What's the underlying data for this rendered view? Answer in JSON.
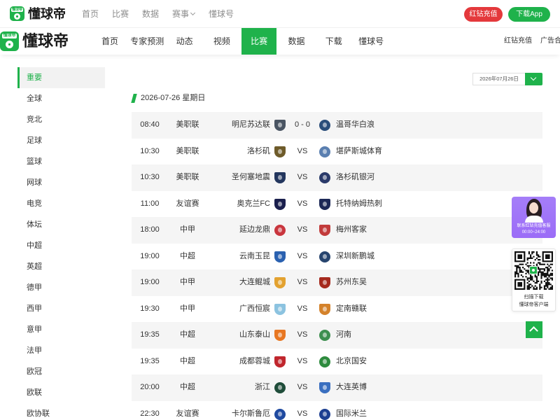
{
  "colors": {
    "accent_green": "#1fb24b",
    "recharge_red": "#e4393c",
    "text_dark": "#333333",
    "text_gray": "#8c8c8c",
    "row_alt_bg": "#f5f5f5",
    "service_purple": "#9b6cf7"
  },
  "top_bar": {
    "logo_icon": "dongqiudi-logo-icon",
    "logo_badge_text": "懂球帝",
    "brand": "懂球帝",
    "nav": [
      "首页",
      "比赛",
      "数据",
      "赛事",
      "懂球号"
    ],
    "dropdown_icon": "chevron-down-icon",
    "recharge_button": "红钻充值",
    "download_button": "下载App"
  },
  "main_nav": {
    "logo_badge_text": "懂球帝",
    "brand": "懂球帝",
    "items": [
      "首页",
      "专家预测",
      "动态",
      "视频",
      "比赛",
      "数据",
      "下载",
      "懂球号"
    ],
    "active_index": 4,
    "recharge_link": "红钻充值",
    "ad_link": "广告合"
  },
  "sidebar": {
    "items": [
      "重要",
      "全球",
      "竞北",
      "足球",
      "篮球",
      "网球",
      "电竞",
      "体坛",
      "中超",
      "英超",
      "德甲",
      "西甲",
      "意甲",
      "法甲",
      "欧冠",
      "欧联",
      "欧协联"
    ],
    "active_index": 0
  },
  "date_picker": {
    "value": "2026年07月26日",
    "icon": "chevron-down-icon"
  },
  "date_header": "2026-07-26 星期日",
  "matches": [
    {
      "time": "08:40",
      "league": "美职联",
      "home": "明尼苏达联",
      "score": "0 - 0",
      "away": "温哥华白浪",
      "home_logo": {
        "icon": "shield-crest",
        "color": "#4a5563"
      },
      "away_logo": {
        "icon": "round-crest",
        "color": "#2a4d7a"
      }
    },
    {
      "time": "10:30",
      "league": "美职联",
      "home": "洛杉矶",
      "score": "VS",
      "away": "堪萨斯城体育",
      "home_logo": {
        "icon": "shield-crest",
        "color": "#6e5b2a"
      },
      "away_logo": {
        "icon": "round-crest",
        "color": "#5a7fb0"
      }
    },
    {
      "time": "10:30",
      "league": "美职联",
      "home": "圣何塞地震",
      "score": "VS",
      "away": "洛杉矶银河",
      "home_logo": {
        "icon": "shield-crest",
        "color": "#23365e"
      },
      "away_logo": {
        "icon": "round-crest",
        "color": "#2a3a6a"
      }
    },
    {
      "time": "11:00",
      "league": "友谊赛",
      "home": "奥克兰FC",
      "score": "VS",
      "away": "托特纳姆热刺",
      "home_logo": {
        "icon": "shield-crest",
        "color": "#1a1f4d"
      },
      "away_logo": {
        "icon": "shield-crest",
        "color": "#1c2856"
      }
    },
    {
      "time": "18:00",
      "league": "中甲",
      "home": "延边龙鼎",
      "score": "VS",
      "away": "梅州客家",
      "home_logo": {
        "icon": "round-crest",
        "color": "#c9363e"
      },
      "away_logo": {
        "icon": "shield-crest",
        "color": "#c23b3b"
      }
    },
    {
      "time": "19:00",
      "league": "中超",
      "home": "云南玉昆",
      "score": "VS",
      "away": "深圳新鹏城",
      "home_logo": {
        "icon": "shield-crest",
        "color": "#2a61b0"
      },
      "away_logo": {
        "icon": "round-crest",
        "color": "#27446e"
      }
    },
    {
      "time": "19:00",
      "league": "中甲",
      "home": "大连鲲城",
      "score": "VS",
      "away": "苏州东吴",
      "home_logo": {
        "icon": "shield-crest",
        "color": "#e3a230"
      },
      "away_logo": {
        "icon": "shield-crest",
        "color": "#a52a1e"
      }
    },
    {
      "time": "19:30",
      "league": "中甲",
      "home": "广西恒宸",
      "score": "VS",
      "away": "定南赣联",
      "home_logo": {
        "icon": "shield-crest",
        "color": "#8cc3e0"
      },
      "away_logo": {
        "icon": "shield-crest",
        "color": "#d4822b"
      }
    },
    {
      "time": "19:35",
      "league": "中超",
      "home": "山东泰山",
      "score": "VS",
      "away": "河南",
      "home_logo": {
        "icon": "shield-crest",
        "color": "#e87722"
      },
      "away_logo": {
        "icon": "round-crest",
        "color": "#3d8f4f"
      }
    },
    {
      "time": "19:35",
      "league": "中超",
      "home": "成都蓉城",
      "score": "VS",
      "away": "北京国安",
      "home_logo": {
        "icon": "shield-crest",
        "color": "#c0262d"
      },
      "away_logo": {
        "icon": "round-crest",
        "color": "#2e8b3e"
      }
    },
    {
      "time": "20:00",
      "league": "中超",
      "home": "浙江",
      "score": "VS",
      "away": "大连英博",
      "home_logo": {
        "icon": "round-crest",
        "color": "#1f4d3a"
      },
      "away_logo": {
        "icon": "shield-crest",
        "color": "#3a6fc0"
      }
    },
    {
      "time": "22:30",
      "league": "友谊赛",
      "home": "卡尔斯鲁厄",
      "score": "VS",
      "away": "国际米兰",
      "home_logo": {
        "icon": "round-crest",
        "color": "#1f4aa0"
      },
      "away_logo": {
        "icon": "round-crest",
        "color": "#1d3f91"
      }
    }
  ],
  "float_panel": {
    "service_avatar_icon": "customer-service-avatar",
    "service_title": "联系红钻充值客服",
    "service_hours": "00:00~24:00",
    "qr_icon": "qr-code",
    "qr_line1": "扫描下载",
    "qr_line2": "懂球帝客户端",
    "back_to_top_icon": "chevron-up-icon"
  }
}
